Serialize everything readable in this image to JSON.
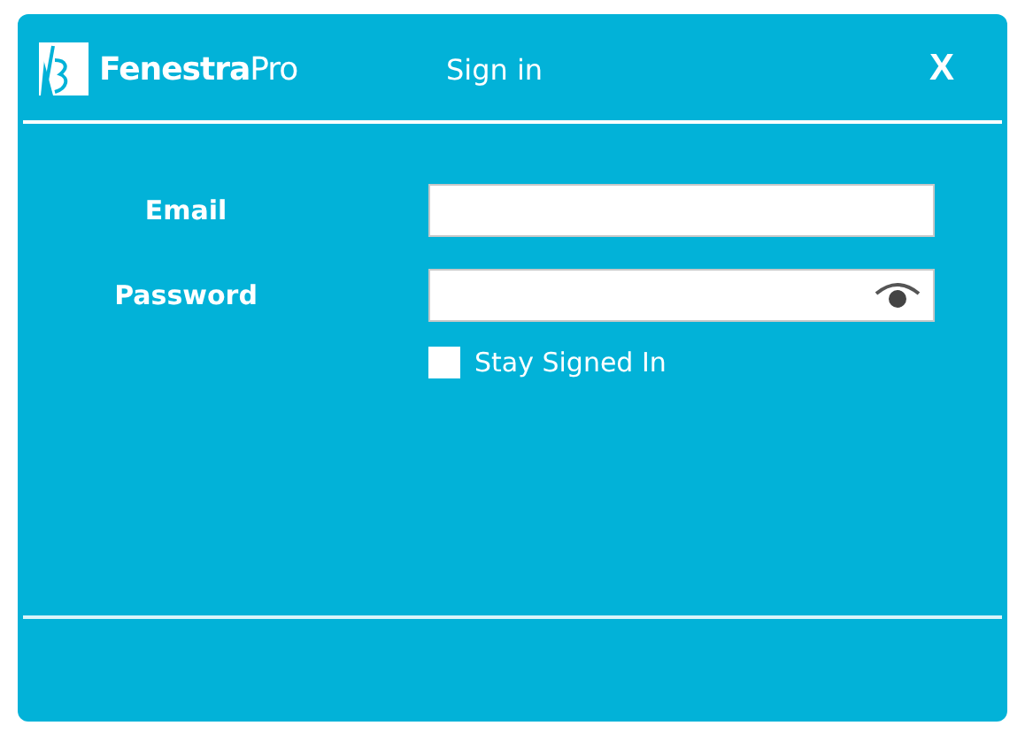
{
  "window": {
    "logo": "**Fenestra**Pro",
    "title": "Sign in",
    "close": "X"
  },
  "fields": [
    {
      "label": "Email",
      "kind": "text"
    },
    {
      "label": "Password",
      "kind": "password"
    }
  ],
  "stay_signed_in": {
    "label": "Stay Signed In",
    "checked": false
  }
}
